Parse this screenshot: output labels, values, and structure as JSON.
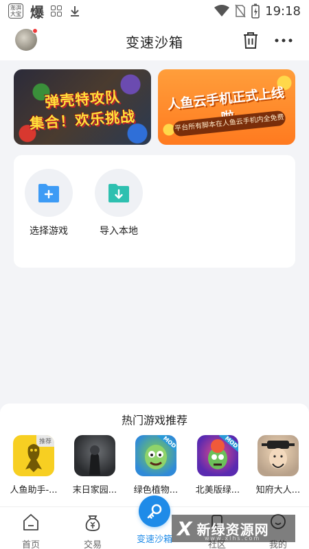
{
  "status_bar": {
    "app_icon_text": "澎湃大宝",
    "bao_char": "爆",
    "time": "19:18"
  },
  "header": {
    "title": "变速沙箱",
    "icons": {
      "avatar": "user-avatar",
      "trash": "trash-icon",
      "more": "more-icon"
    }
  },
  "banners": [
    {
      "line1": "弹壳特攻队",
      "line2": "集合！欢乐挑战"
    },
    {
      "title": "人鱼云手机正式上线啦",
      "subtitle": "平台所有脚本在人鱼云手机内全免费"
    }
  ],
  "actions": [
    {
      "label": "选择游戏",
      "icon": "folder-add-icon",
      "color": "#3d9bf5"
    },
    {
      "label": "导入本地",
      "icon": "folder-import-icon",
      "color": "#2ec0b0"
    }
  ],
  "hot_games": {
    "title": "热门游戏推荐",
    "items": [
      {
        "name": "人鱼助手-...",
        "tag": "推荐"
      },
      {
        "name": "末日家园..."
      },
      {
        "name": "绿色植物...",
        "tag": "MOD"
      },
      {
        "name": "北美版绿...",
        "tag": "MOD"
      },
      {
        "name": "知府大人..."
      }
    ]
  },
  "bottom_nav": [
    {
      "label": "首页",
      "icon": "home-icon"
    },
    {
      "label": "交易",
      "icon": "trade-icon"
    },
    {
      "label": "变速沙箱",
      "icon": "speed-key-icon",
      "active": true,
      "active_color": "#1f8be8"
    },
    {
      "label": "社区",
      "icon": "community-icon"
    },
    {
      "label": "我的",
      "icon": "profile-icon"
    }
  ],
  "watermark": {
    "text": "新绿资源网",
    "url": "www.xlhs.com"
  }
}
